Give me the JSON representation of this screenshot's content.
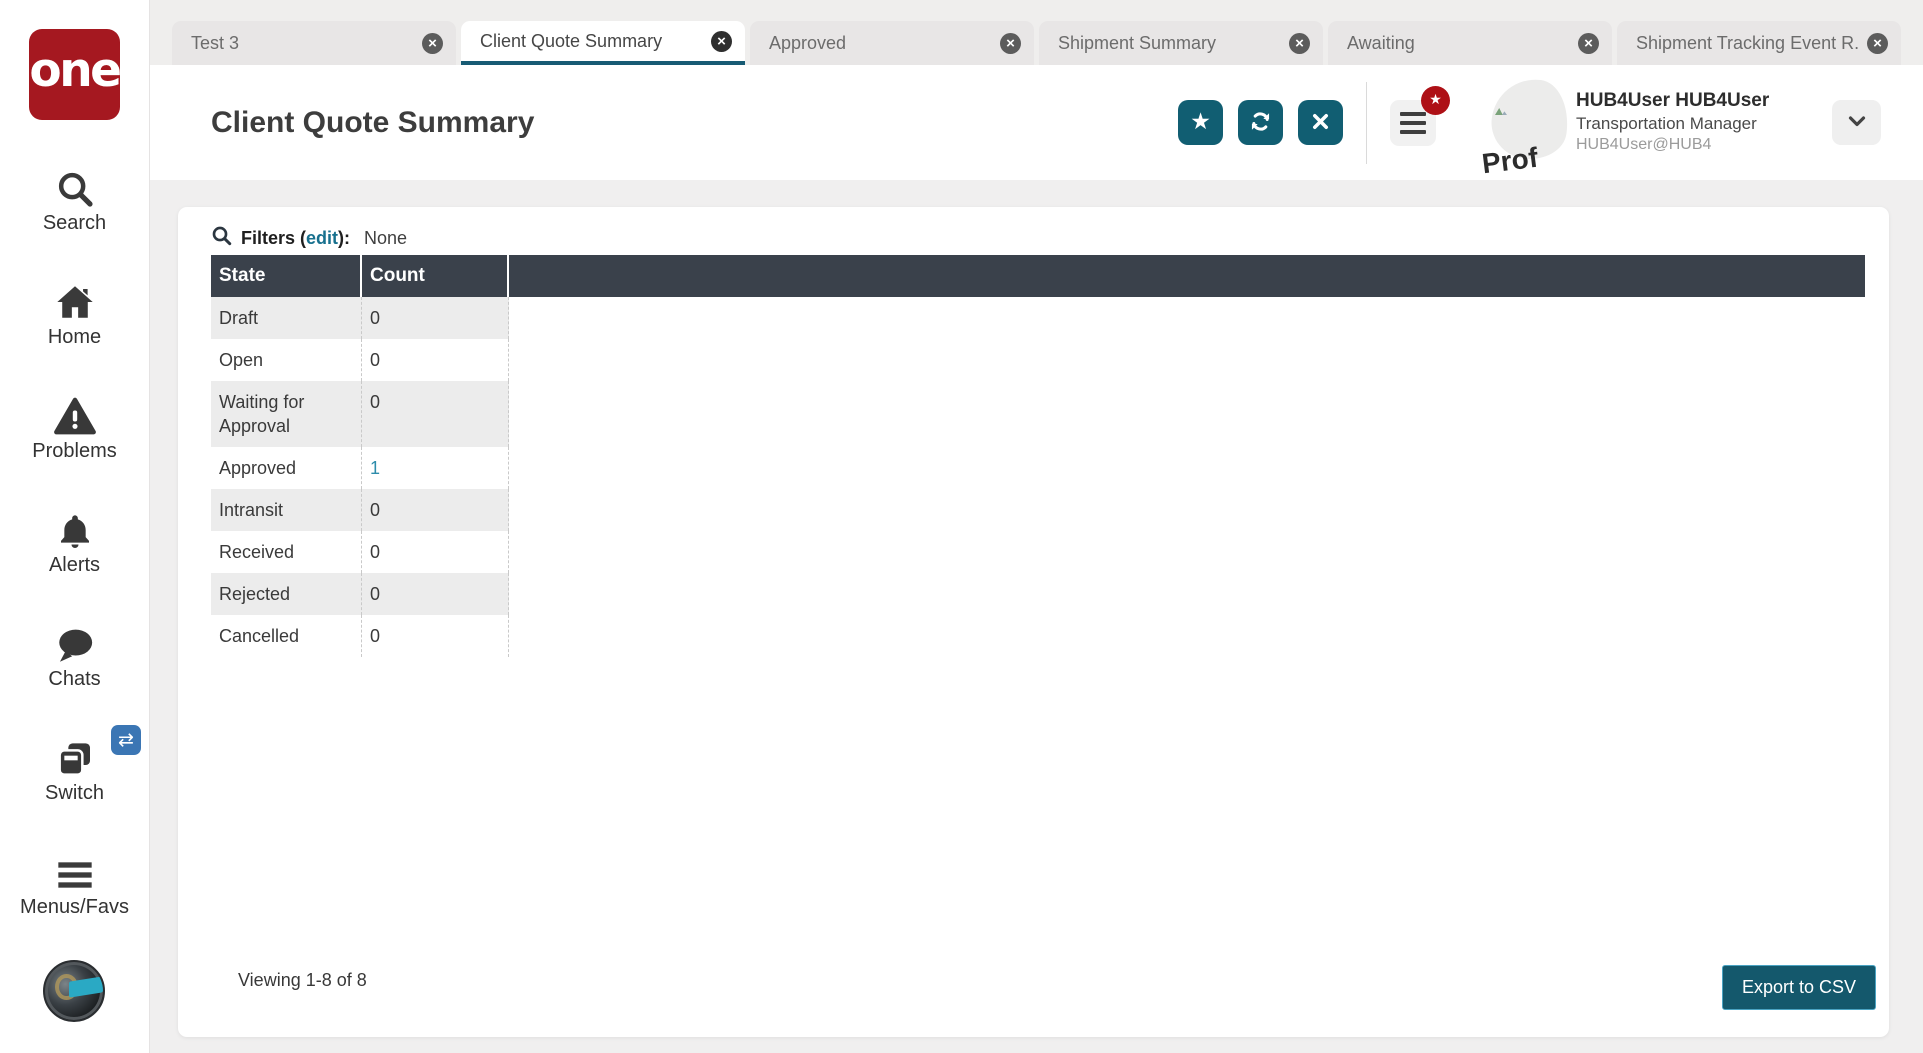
{
  "app": {
    "logo_text": "one"
  },
  "sidebar": {
    "items": [
      {
        "label": "Search"
      },
      {
        "label": "Home"
      },
      {
        "label": "Problems"
      },
      {
        "label": "Alerts"
      },
      {
        "label": "Chats"
      },
      {
        "label": "Switch"
      },
      {
        "label": "Menus/Favs"
      }
    ]
  },
  "tabs": [
    {
      "label": "Test 3",
      "active": false
    },
    {
      "label": "Client Quote Summary",
      "active": true
    },
    {
      "label": "Approved",
      "active": false
    },
    {
      "label": "Shipment Summary",
      "active": false
    },
    {
      "label": "Awaiting",
      "active": false
    },
    {
      "label": "Shipment Tracking Event R...",
      "active": false
    }
  ],
  "header": {
    "title": "Client Quote Summary",
    "user": {
      "name": "HUB4User HUB4User",
      "role": "Transportation Manager",
      "org": "HUB4User@HUB4",
      "avatar_alt": "Prof"
    }
  },
  "filters": {
    "prefix": "Filters (",
    "edit_link": "edit",
    "suffix": "):",
    "value": "None"
  },
  "table": {
    "columns": {
      "state": "State",
      "count": "Count"
    },
    "rows": [
      {
        "state": "Draft",
        "count": "0",
        "is_link": false
      },
      {
        "state": "Open",
        "count": "0",
        "is_link": false
      },
      {
        "state": "Waiting for Approval",
        "count": "0",
        "is_link": false
      },
      {
        "state": "Approved",
        "count": "1",
        "is_link": true
      },
      {
        "state": "Intransit",
        "count": "0",
        "is_link": false
      },
      {
        "state": "Received",
        "count": "0",
        "is_link": false
      },
      {
        "state": "Rejected",
        "count": "0",
        "is_link": false
      },
      {
        "state": "Cancelled",
        "count": "0",
        "is_link": false
      }
    ]
  },
  "footer": {
    "viewing": "Viewing 1-8 of 8",
    "export_label": "Export to CSV"
  },
  "icons": {
    "star_glyph": "★",
    "close_glyph": "×",
    "swap_glyph": "⇄"
  },
  "colors": {
    "brand_red": "#a51820",
    "action_teal": "#115e72",
    "active_tab_underline": "#175b74",
    "table_header_bg": "#3a414b",
    "edit_link_teal": "#17708e",
    "count_link_teal": "#2d8cab",
    "badge_red": "#ae1016"
  }
}
